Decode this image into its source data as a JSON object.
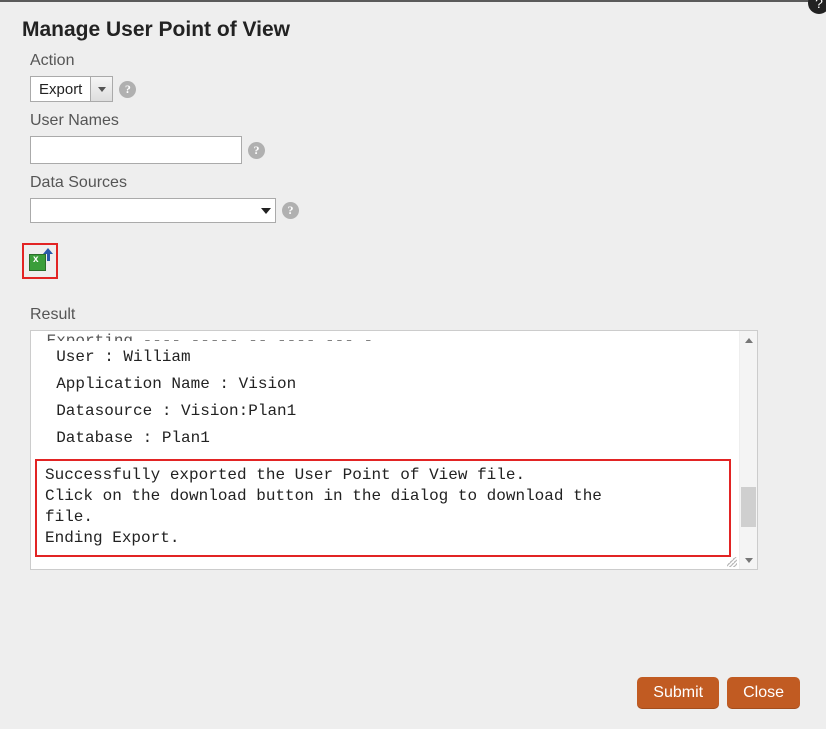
{
  "dialog": {
    "title": "Manage User Point of View"
  },
  "form": {
    "action_label": "Action",
    "action_value": "Export",
    "user_names_label": "User Names",
    "user_names_value": "",
    "data_sources_label": "Data Sources",
    "data_sources_value": "",
    "result_label": "Result"
  },
  "result": {
    "truncated_top": " Exporting ---- ----- -- ---- --- -",
    "line1": "  User : William",
    "line2": "  Application Name : Vision",
    "line3": "  Datasource : Vision:Plan1",
    "line4": "  Database : Plan1",
    "msg1": "Successfully exported the User Point of View file.",
    "msg2": "Click on the download button in the dialog to download the",
    "msg3": "file.",
    "msg4": "Ending Export."
  },
  "buttons": {
    "submit": "Submit",
    "close": "Close"
  },
  "icons": {
    "help": "?"
  }
}
